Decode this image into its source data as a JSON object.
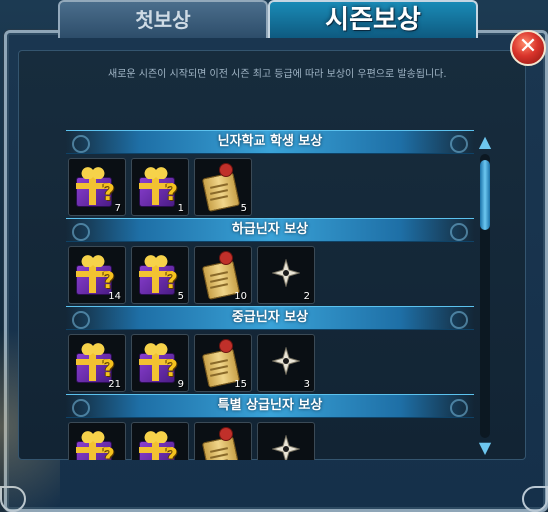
{
  "tabs": [
    {
      "label": "첫보상",
      "active": false
    },
    {
      "label": "시즌보상",
      "active": true
    }
  ],
  "close_label": "✕",
  "notice": "새로운 시즌이 시작되면 이전 시즌 최고 등급에 따라 보상이 우편으로 발송됩니다.",
  "colors": {
    "accent": "#3aa3d8",
    "tab_active": "#1a8bb6",
    "close": "#d9342b"
  },
  "reward_groups": [
    {
      "title": "닌자학교 학생 보상",
      "items": [
        {
          "icon": "mystery-gift-icon",
          "qty": "7"
        },
        {
          "icon": "mystery-gift-icon",
          "qty": "1"
        },
        {
          "icon": "scroll-icon",
          "qty": "5"
        }
      ]
    },
    {
      "title": "하급닌자 보상",
      "items": [
        {
          "icon": "mystery-gift-icon",
          "qty": "14"
        },
        {
          "icon": "mystery-gift-icon",
          "qty": "5"
        },
        {
          "icon": "scroll-icon",
          "qty": "10"
        },
        {
          "icon": "shuriken-icon",
          "qty": "2"
        }
      ]
    },
    {
      "title": "중급닌자 보상",
      "items": [
        {
          "icon": "mystery-gift-icon",
          "qty": "21"
        },
        {
          "icon": "mystery-gift-icon",
          "qty": "9"
        },
        {
          "icon": "scroll-icon",
          "qty": "15"
        },
        {
          "icon": "shuriken-icon",
          "qty": "3"
        }
      ]
    },
    {
      "title": "특별 상급닌자 보상",
      "items": [
        {
          "icon": "mystery-gift-icon",
          "qty": ""
        },
        {
          "icon": "mystery-gift-icon",
          "qty": ""
        },
        {
          "icon": "scroll-icon",
          "qty": ""
        },
        {
          "icon": "shuriken-icon",
          "qty": ""
        }
      ]
    }
  ],
  "scrollbar": {
    "up_glyph": "▲",
    "down_glyph": "▼"
  }
}
